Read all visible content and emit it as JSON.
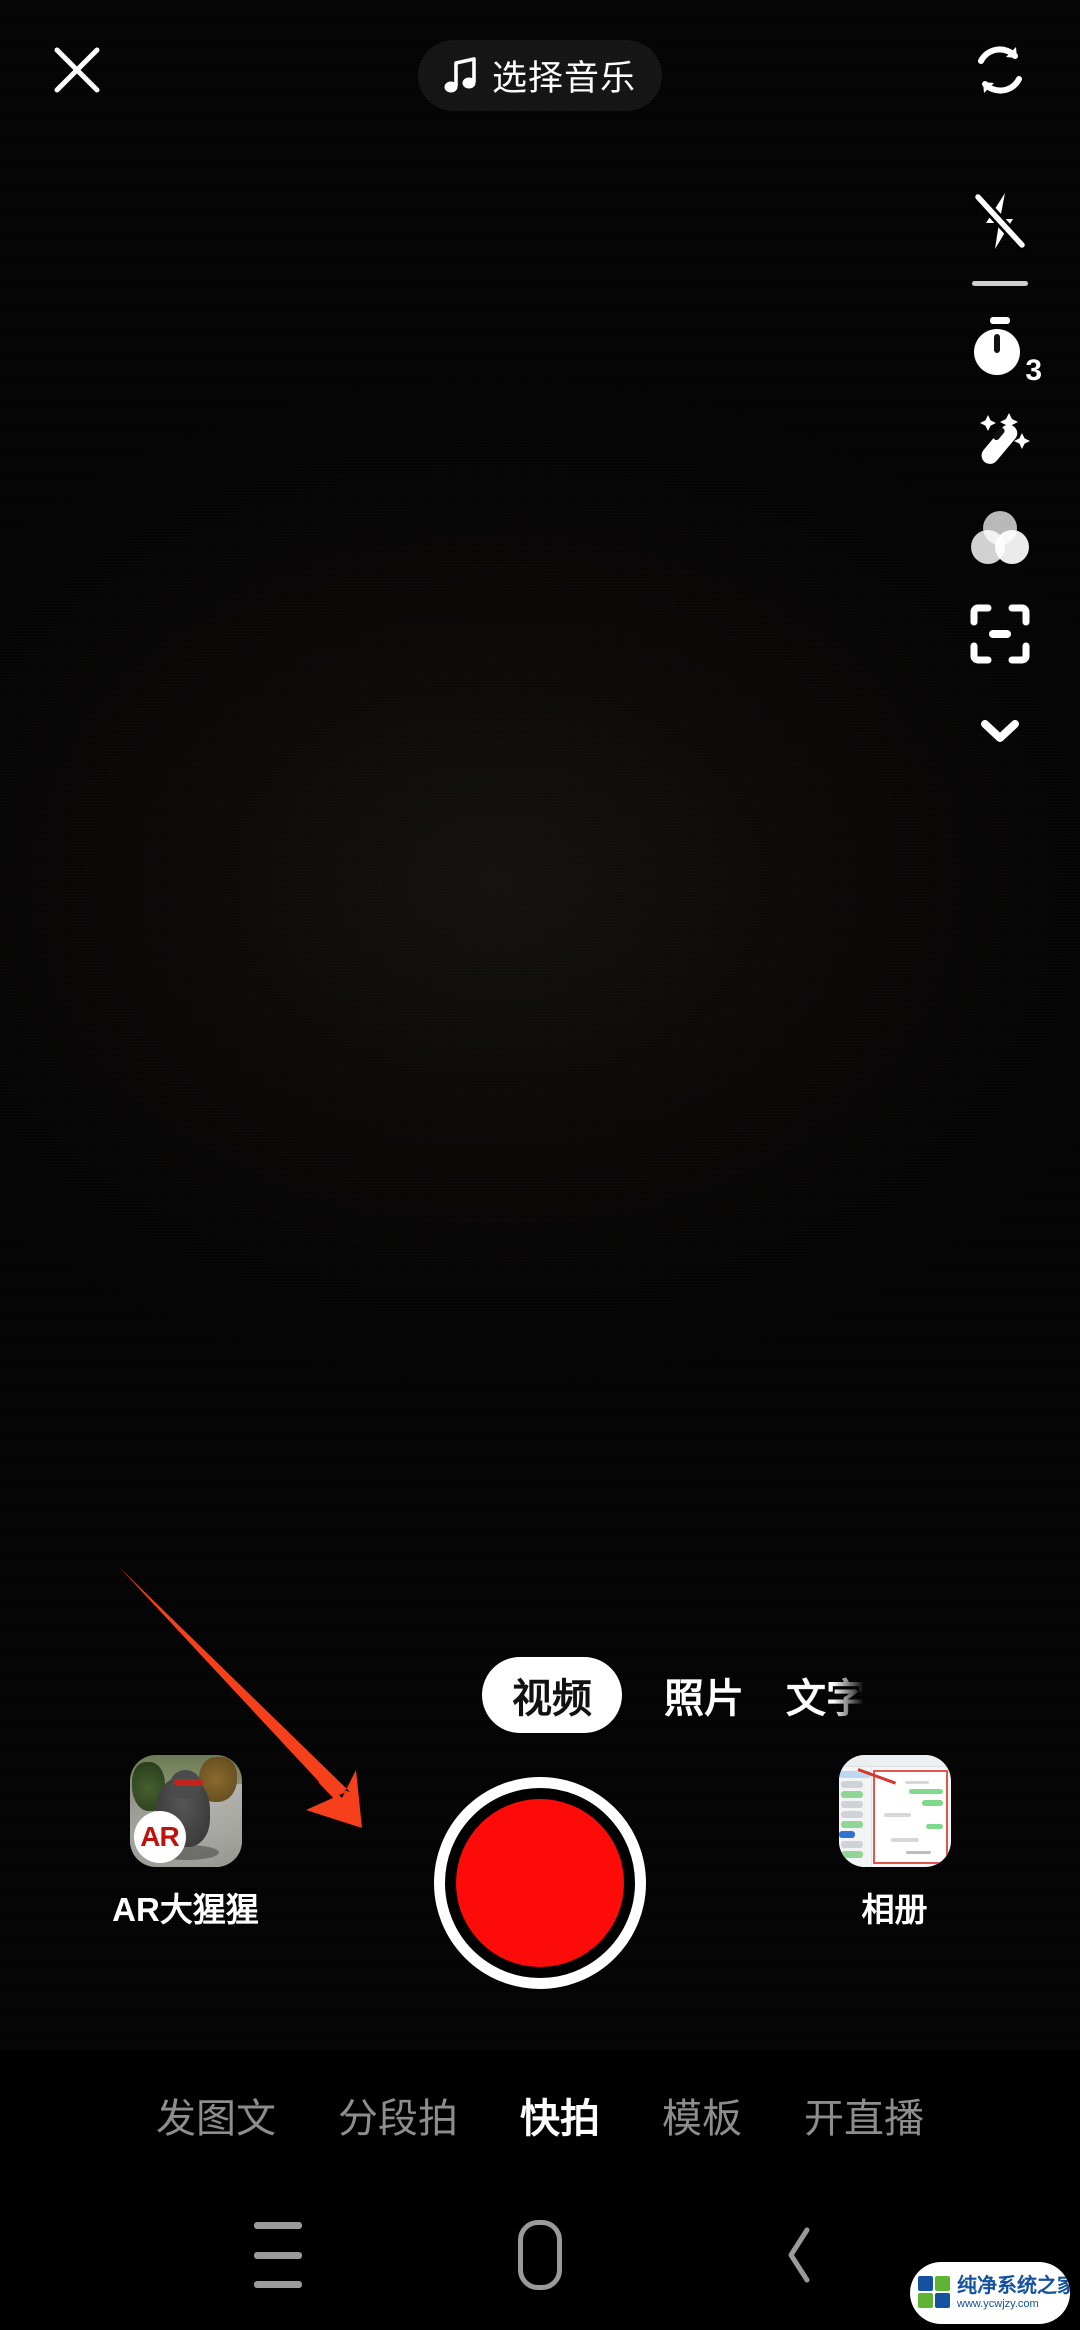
{
  "app": {
    "screen_name": "camera-capture",
    "background_color": "#020202",
    "accent_record_color": "#fc0b09",
    "annotation_arrow_color": "#f6401c"
  },
  "top_bar": {
    "close_icon": "close-icon",
    "music": {
      "icon": "music-note-icon",
      "label": "选择音乐"
    },
    "flip_camera_icon": "flip-camera-icon"
  },
  "right_toolbar": {
    "items": [
      {
        "name": "flash-off-icon",
        "label": "",
        "badge": ""
      },
      {
        "name": "divider",
        "label": "",
        "badge": ""
      },
      {
        "name": "timer-icon",
        "label": "",
        "badge": "3"
      },
      {
        "name": "beauty-wand-icon",
        "label": "",
        "badge": ""
      },
      {
        "name": "filter-icon",
        "label": "",
        "badge": ""
      },
      {
        "name": "scan-icon",
        "label": "",
        "badge": ""
      },
      {
        "name": "chevron-down-icon",
        "label": "",
        "badge": ""
      }
    ]
  },
  "mode_switcher": {
    "selected": "视频",
    "modes": [
      {
        "label": "视频",
        "active": true,
        "clipped": false
      },
      {
        "label": "照片",
        "active": false,
        "clipped": false
      },
      {
        "label": "文字",
        "active": false,
        "clipped": true
      }
    ]
  },
  "capture_row": {
    "effect": {
      "label": "AR大猩猩",
      "badge": "AR"
    },
    "record_button_label": "",
    "album": {
      "label": "相册"
    }
  },
  "bottom_tabs": {
    "active": "快拍",
    "items": [
      {
        "label": "发图文",
        "active": false
      },
      {
        "label": "分段拍",
        "active": false
      },
      {
        "label": "快拍",
        "active": true
      },
      {
        "label": "模板",
        "active": false
      },
      {
        "label": "开直播",
        "active": false
      }
    ]
  },
  "system_nav": {
    "menu_icon": "menu-icon",
    "home_icon": "home-icon",
    "back_icon": "back-icon"
  },
  "watermark": {
    "title": "纯净系统之家",
    "url": "www.ycwjzy.com",
    "color_blue": "#1452a0",
    "color_green": "#5fb533"
  }
}
